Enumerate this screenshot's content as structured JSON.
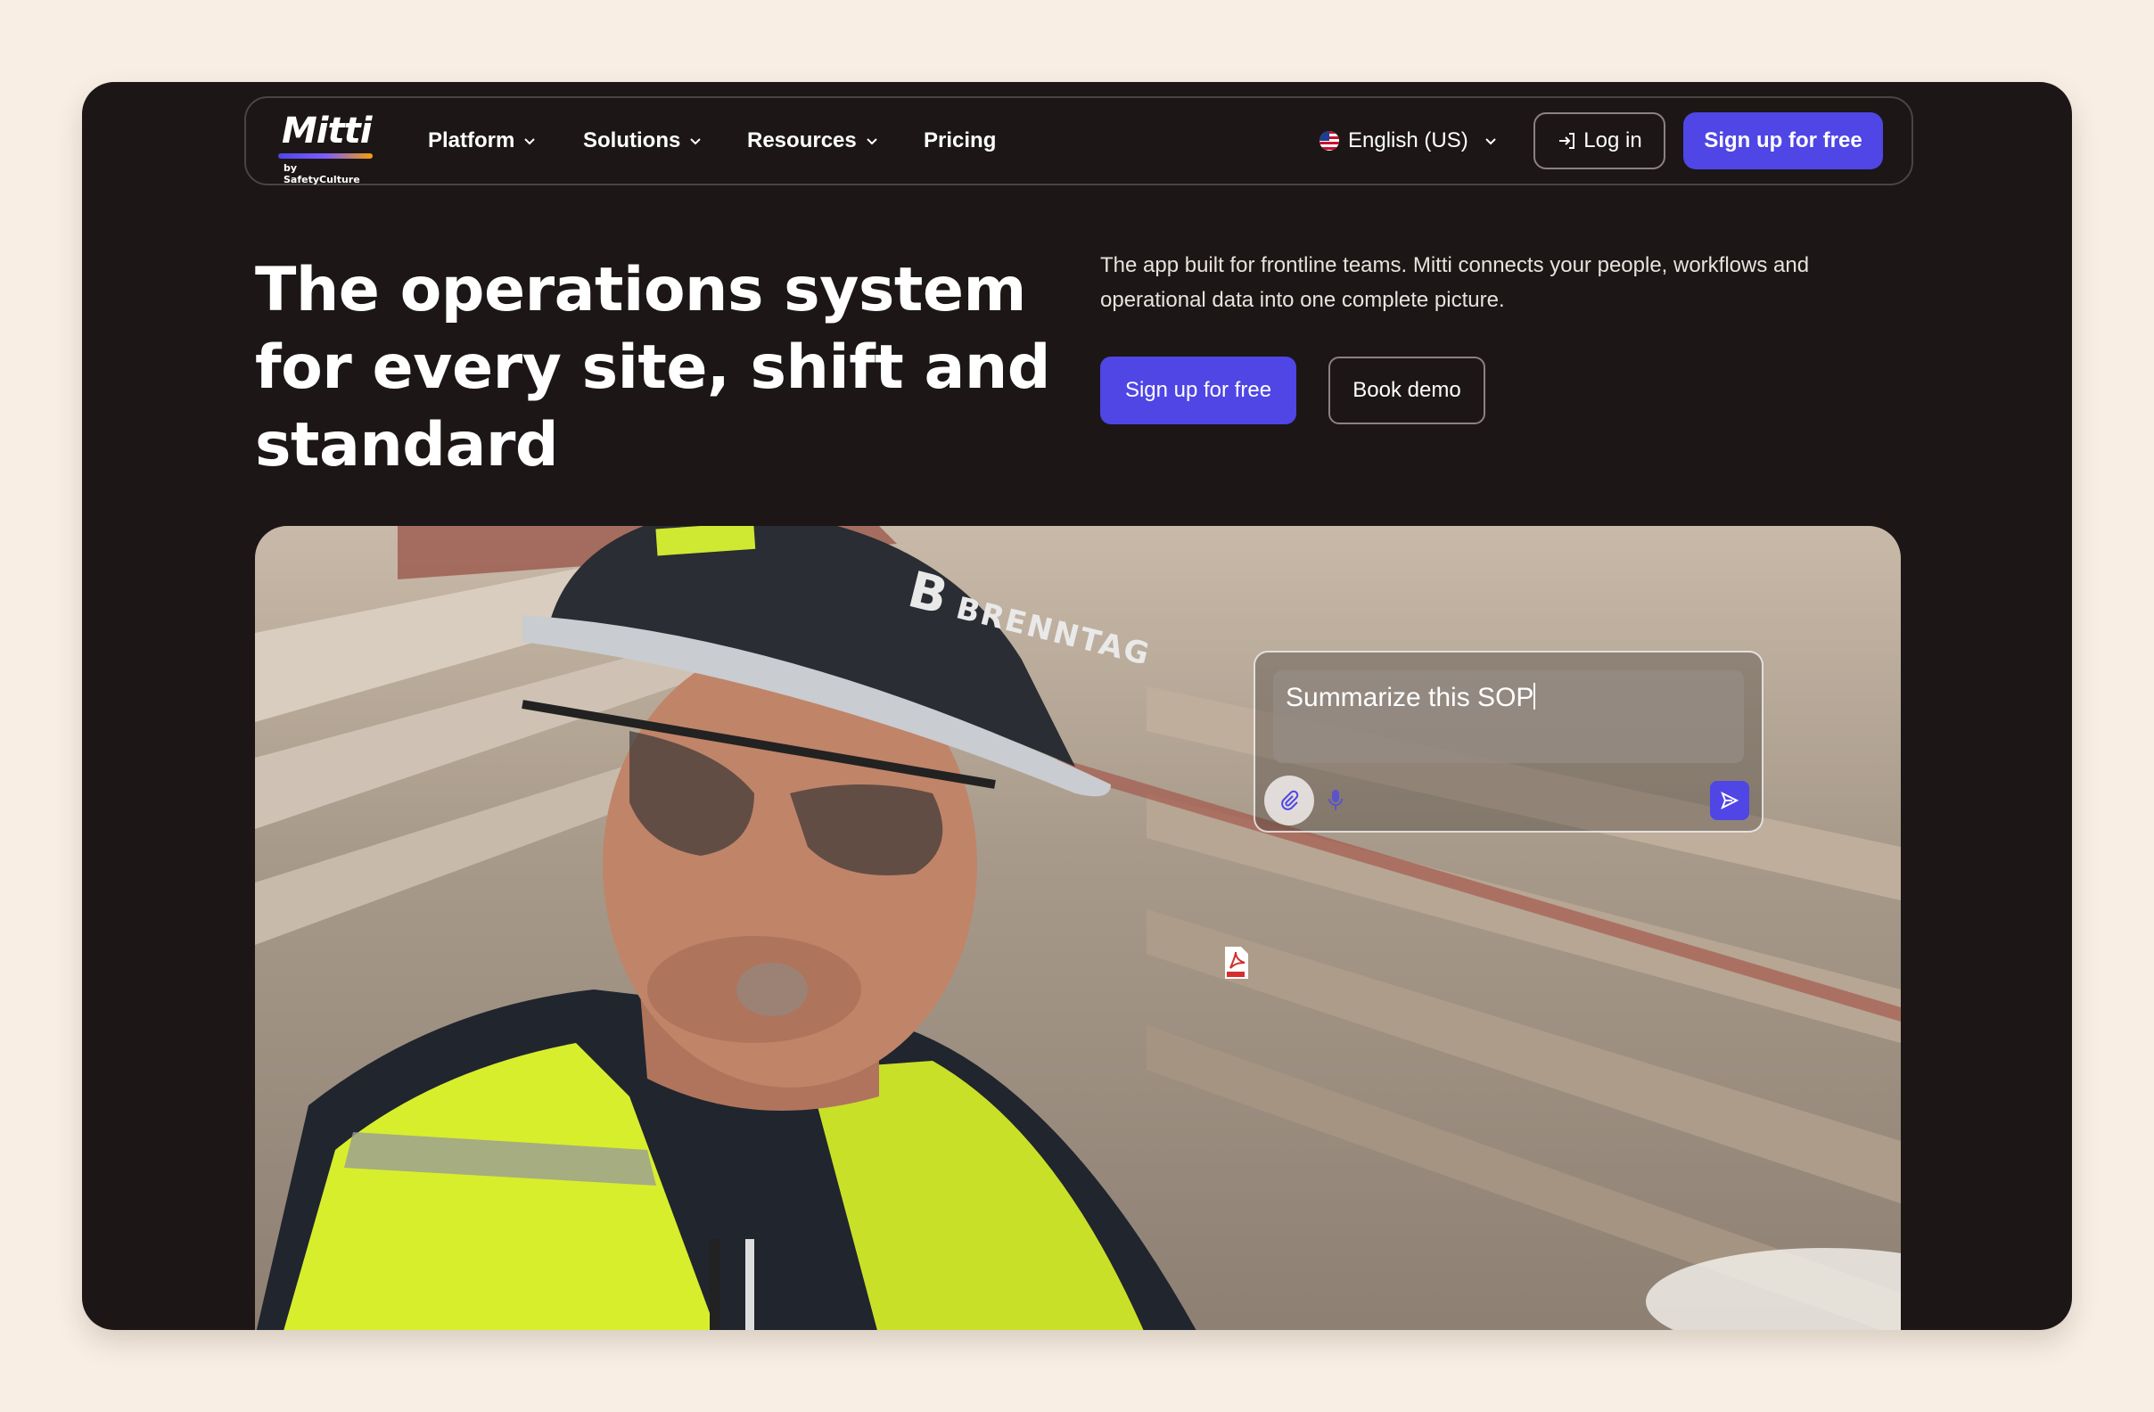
{
  "nav": {
    "logo": {
      "word": "Mitti",
      "sub": "by SafetyCulture"
    },
    "items": [
      {
        "label": "Platform",
        "has_dropdown": true
      },
      {
        "label": "Solutions",
        "has_dropdown": true
      },
      {
        "label": "Resources",
        "has_dropdown": true
      },
      {
        "label": "Pricing",
        "has_dropdown": false
      }
    ],
    "language": "English (US)",
    "login_label": "Log in",
    "signup_label": "Sign up for free"
  },
  "hero": {
    "headline": "The operations system for every site, shift and standard",
    "subtext": "The app built for frontline teams. Mitti connects your people, workflows and operational data into one complete picture.",
    "cta_primary": "Sign up for free",
    "cta_secondary": "Book demo"
  },
  "photo": {
    "hat_brand": "BRENNTAG",
    "hat_logo_letter": "B",
    "chat_prompt": "Summarize this SOP"
  },
  "colors": {
    "accent": "#4f46e5",
    "frame_bg": "#1c1716",
    "page_bg": "#f8eee4"
  },
  "icons": [
    "chevron-down-icon",
    "us-flag-icon",
    "login-icon",
    "paperclip-icon",
    "microphone-icon",
    "send-icon",
    "pdf-file-icon"
  ]
}
